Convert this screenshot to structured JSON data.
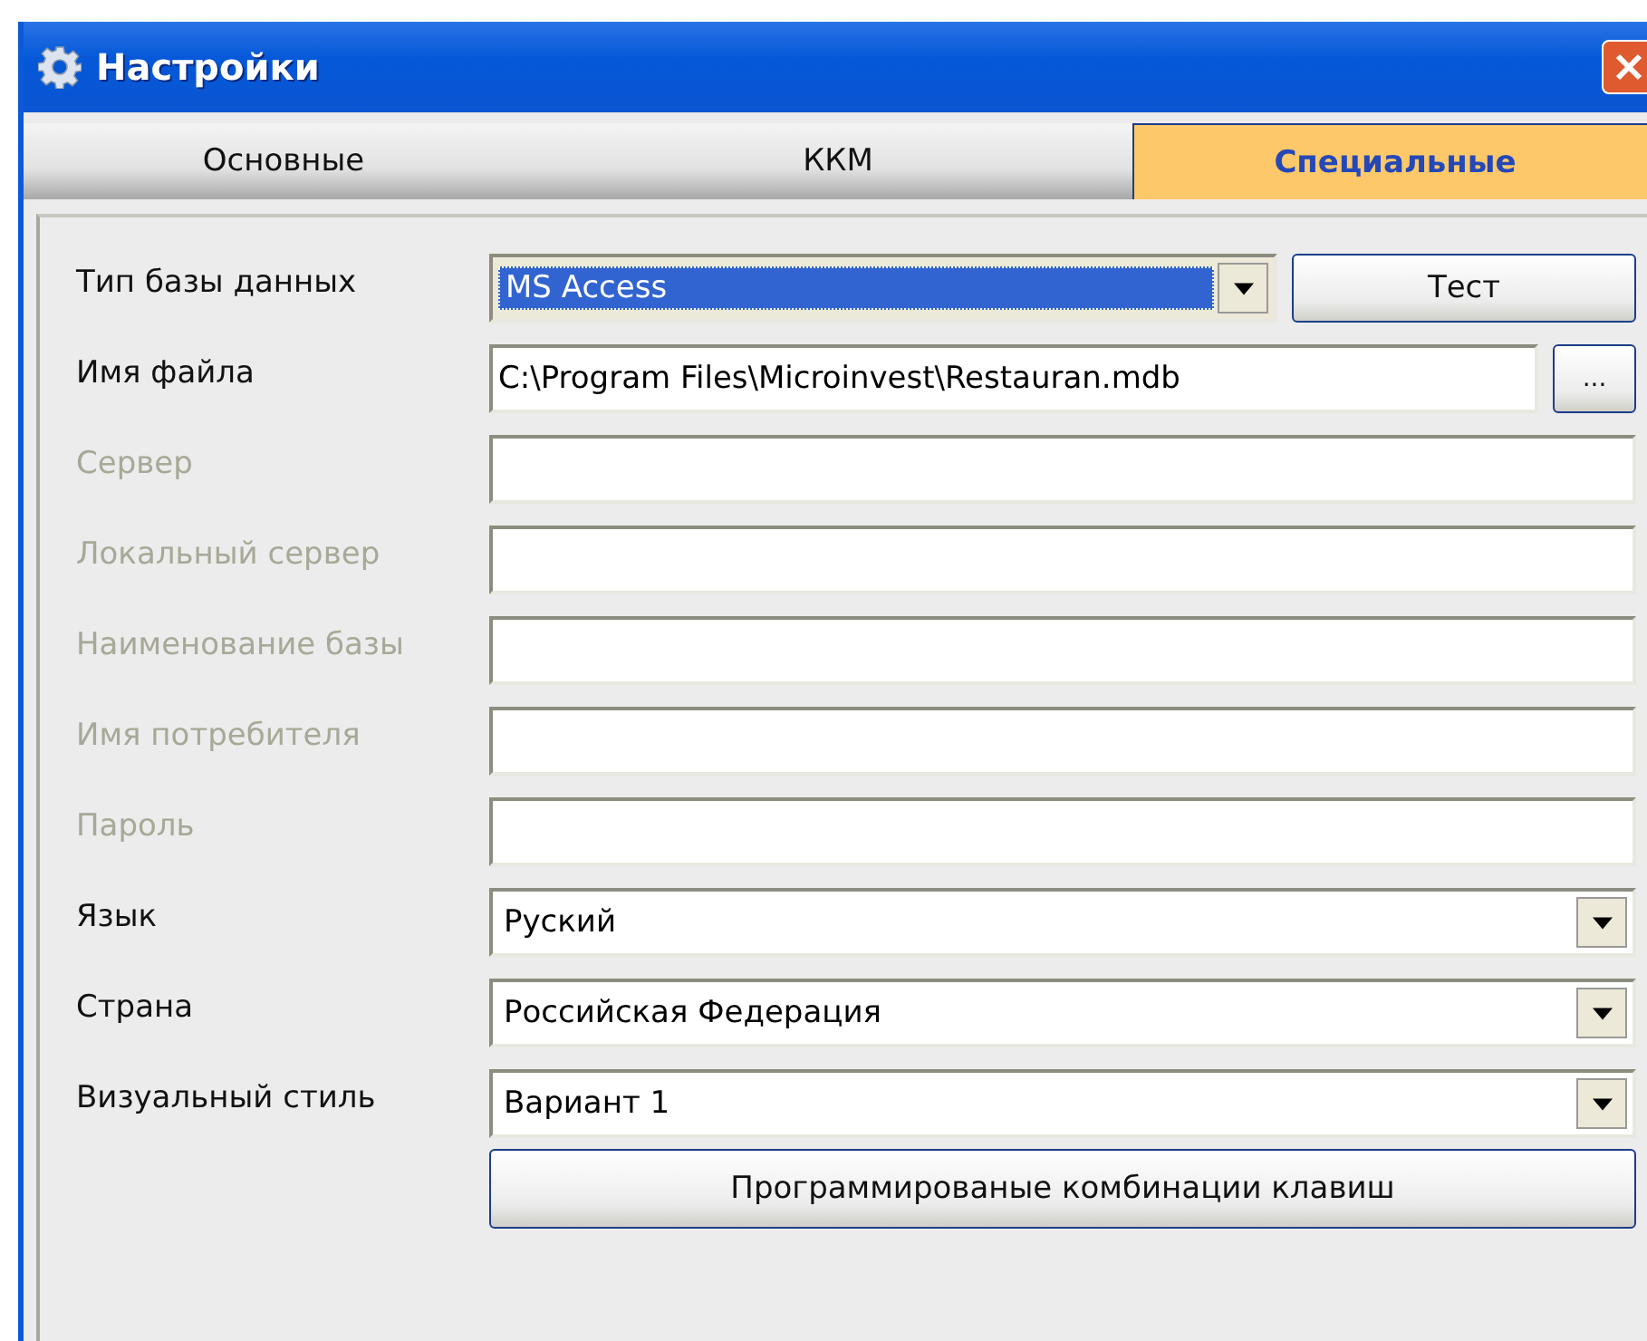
{
  "window": {
    "title": "Настройки"
  },
  "tabs": [
    {
      "label": "Основные",
      "selected": false
    },
    {
      "label": "ККМ",
      "selected": false
    },
    {
      "label": "Специальные",
      "selected": true
    }
  ],
  "fields": [
    {
      "label": "Тип базы данных",
      "disabled": false,
      "kind": "combo",
      "value": "MS Access",
      "highlighted": true,
      "button": "Тест"
    },
    {
      "label": "Имя файла",
      "disabled": false,
      "kind": "text",
      "value": "C:\\Program Files\\Microinvest\\Restauran.mdb",
      "button": "..."
    },
    {
      "label": "Сервер",
      "disabled": true,
      "kind": "text"
    },
    {
      "label": "Локальный сервер",
      "disabled": true,
      "kind": "text"
    },
    {
      "label": "Наименование базы",
      "disabled": true,
      "kind": "text"
    },
    {
      "label": "Имя потребителя",
      "disabled": true,
      "kind": "text"
    },
    {
      "label": "Пароль",
      "disabled": true,
      "kind": "text"
    },
    {
      "label": "Язык",
      "disabled": false,
      "kind": "combo",
      "value": "Руский",
      "highlighted": false
    },
    {
      "label": "Страна",
      "disabled": false,
      "kind": "combo",
      "value": "Российская Федерация",
      "highlighted": false
    },
    {
      "label": "Визуальный стиль",
      "disabled": false,
      "kind": "combo",
      "value": "Вариант 1",
      "highlighted": false
    }
  ],
  "shortcuts_button": "Программированые комбинации клавиш"
}
